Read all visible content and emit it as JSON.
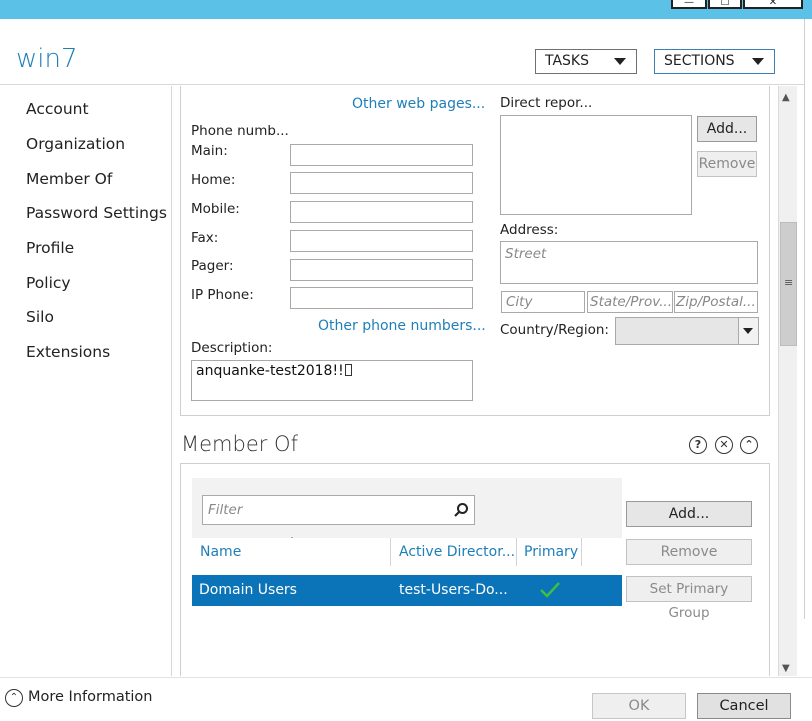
{
  "window": {
    "minimize_glyph": "—",
    "maximize_glyph": "☐",
    "close_glyph": "✕"
  },
  "header": {
    "title": "win7",
    "tasks_label": "TASKS",
    "sections_label": "SECTIONS"
  },
  "sidebar": {
    "items": [
      {
        "label": "Account"
      },
      {
        "label": "Organization"
      },
      {
        "label": "Member Of"
      },
      {
        "label": "Password Settings"
      },
      {
        "label": "Profile"
      },
      {
        "label": "Policy"
      },
      {
        "label": "Silo"
      },
      {
        "label": "Extensions"
      }
    ]
  },
  "organization": {
    "other_web_pages": "Other web pages...",
    "phone_numbers_label": "Phone numb...",
    "phones": [
      {
        "label": "Main:",
        "value": ""
      },
      {
        "label": "Home:",
        "value": ""
      },
      {
        "label": "Mobile:",
        "value": ""
      },
      {
        "label": "Fax:",
        "value": ""
      },
      {
        "label": "Pager:",
        "value": ""
      },
      {
        "label": "IP Phone:",
        "value": ""
      }
    ],
    "other_phone_numbers": "Other phone numbers...",
    "description_label": "Description:",
    "description_value": "anquanke-test2018!!",
    "direct_reports_label": "Direct repor...",
    "add_label": "Add...",
    "remove_label": "Remove",
    "address_label": "Address:",
    "street_placeholder": "Street",
    "city_placeholder": "City",
    "state_placeholder": "State/Prov...",
    "zip_placeholder": "Zip/Postal...",
    "country_label": "Country/Region:"
  },
  "member_of": {
    "title": "Member Of",
    "filter_placeholder": "Filter",
    "columns": [
      "Name",
      "Active Director...",
      "Primary"
    ],
    "rows": [
      {
        "name": "Domain Users",
        "ad_path": "test-Users-Do...",
        "primary": true
      }
    ],
    "add_label": "Add...",
    "remove_label": "Remove",
    "set_primary_label": "Set Primary Group"
  },
  "footer": {
    "more_info": "More Information",
    "ok_label": "OK",
    "cancel_label": "Cancel"
  },
  "colors": {
    "accent": "#1e7fb8",
    "titlebar": "#5cc1e6",
    "selection": "#0b74b8",
    "check": "#3fbf3f"
  }
}
